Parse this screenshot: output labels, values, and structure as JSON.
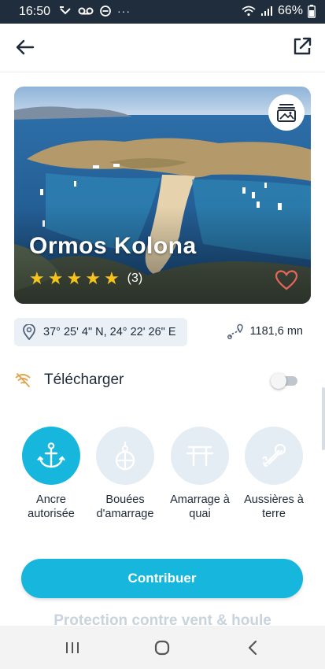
{
  "status_bar": {
    "time": "16:50",
    "battery": "66%"
  },
  "header": {
    "back_icon": "arrow-left-icon",
    "share_icon": "external-link-icon"
  },
  "place": {
    "name": "Ormos Kolona",
    "rating": 5,
    "review_count": "(3)",
    "coordinates": "37° 25' 4\" N, 24° 22' 26\" E",
    "distance": "1181,6 mn"
  },
  "download": {
    "label": "Télécharger",
    "enabled": false
  },
  "features": [
    {
      "label": "Ancre autorisée",
      "icon": "anchor-icon",
      "active": true
    },
    {
      "label": "Bouées d'amarrage",
      "icon": "buoy-icon",
      "active": false
    },
    {
      "label": "Amarrage à quai",
      "icon": "quay-icon",
      "active": false
    },
    {
      "label": "Aussières à terre",
      "icon": "rope-icon",
      "active": false
    }
  ],
  "contribute_label": "Contribuer",
  "next_section_title": "Protection contre vent & houle",
  "colors": {
    "accent": "#16b6dd",
    "star": "#f7c21b",
    "status_bar": "#1f2d3d"
  }
}
